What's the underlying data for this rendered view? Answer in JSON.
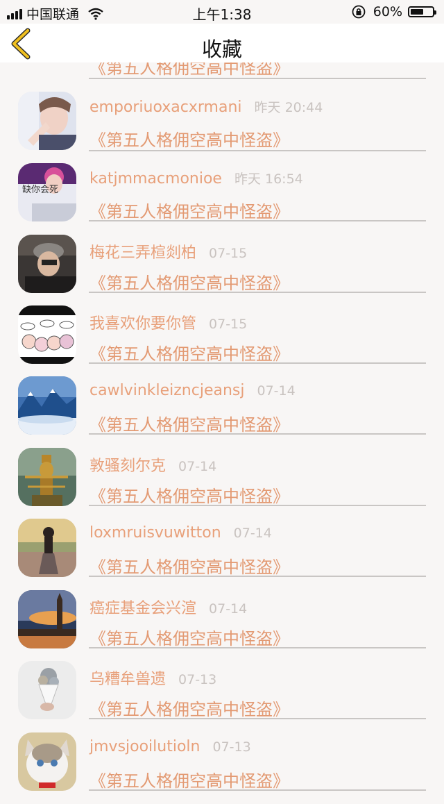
{
  "status_bar": {
    "carrier": "中国联通",
    "time": "上午1:38",
    "battery_percent": "60%",
    "battery_level": 0.6
  },
  "nav": {
    "title": "收藏"
  },
  "colors": {
    "name": "#e8a07a",
    "title": "#e39a73",
    "time": "#c9c3c0",
    "divider": "#c9c6c4",
    "back_arrow": "#f0c020"
  },
  "items": [
    {
      "name": "",
      "time": "",
      "title": "《第五人格佣空高中怪盗》",
      "avatar": "partial-dark-icon"
    },
    {
      "name": "emporiuoxacxrmani",
      "time": "昨天 20:44",
      "title": "《第五人格佣空高中怪盗》",
      "avatar": "portrait-icon"
    },
    {
      "name": "katjmmacmonioe",
      "time": "昨天 16:54",
      "title": "《第五人格佣空高中怪盗》",
      "avatar": "girl-text-icon",
      "avatar_text": "缺你会死"
    },
    {
      "name": "梅花三弄楦剡柏",
      "time": "07-15",
      "title": "《第五人格佣空高中怪盗》",
      "avatar": "cap-man-icon"
    },
    {
      "name": "我喜欢你要你管",
      "time": "07-15",
      "title": "《第五人格佣空高中怪盗》",
      "avatar": "cartoon-group-icon"
    },
    {
      "name": "cawlvinkleizncjeansj",
      "time": "07-14",
      "title": "《第五人格佣空高中怪盗》",
      "avatar": "snow-mountain-icon"
    },
    {
      "name": "敦骚刻尔克",
      "time": "07-14",
      "title": "《第五人格佣空高中怪盗》",
      "avatar": "deity-statue-icon"
    },
    {
      "name": "loxmruisvuwitton",
      "time": "07-14",
      "title": "《第五人格佣空高中怪盗》",
      "avatar": "field-girl-icon"
    },
    {
      "name": "癌症基金会兴渲",
      "time": "07-14",
      "title": "《第五人格佣空高中怪盗》",
      "avatar": "big-ben-icon"
    },
    {
      "name": "乌糟牟兽遗",
      "time": "07-13",
      "title": "《第五人格佣空高中怪盗》",
      "avatar": "bouquet-icon"
    },
    {
      "name": "jmvsjooilutioln",
      "time": "07-13",
      "title": "《第五人格佣空高中怪盗》",
      "avatar": "cat-icon"
    }
  ]
}
